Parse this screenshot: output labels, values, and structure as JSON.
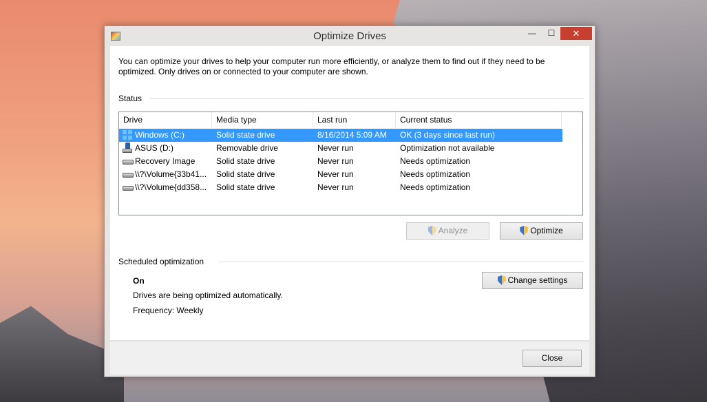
{
  "window": {
    "title": "Optimize Drives",
    "minimize_glyph": "—",
    "maximize_glyph": "☐",
    "close_glyph": "✕"
  },
  "description": "You can optimize your drives to help your computer run more efficiently, or analyze them to find out if they need to be optimized. Only drives on or connected to your computer are shown.",
  "status": {
    "section_label": "Status",
    "columns": [
      "Drive",
      "Media type",
      "Last run",
      "Current status"
    ],
    "drives": [
      {
        "icon": "windows-drive-icon",
        "drive": "Windows (C:)",
        "media_type": "Solid state drive",
        "last_run": "8/16/2014 5:09 AM",
        "current_status": "OK (3 days since last run)",
        "selected": true
      },
      {
        "icon": "usb-drive-icon",
        "drive": "ASUS (D:)",
        "media_type": "Removable drive",
        "last_run": "Never run",
        "current_status": "Optimization not available",
        "selected": false
      },
      {
        "icon": "disk-drive-icon",
        "drive": "Recovery Image",
        "media_type": "Solid state drive",
        "last_run": "Never run",
        "current_status": "Needs optimization",
        "selected": false
      },
      {
        "icon": "disk-drive-icon",
        "drive": "\\\\?\\Volume{33b41...",
        "media_type": "Solid state drive",
        "last_run": "Never run",
        "current_status": "Needs optimization",
        "selected": false
      },
      {
        "icon": "disk-drive-icon",
        "drive": "\\\\?\\Volume{dd358...",
        "media_type": "Solid state drive",
        "last_run": "Never run",
        "current_status": "Needs optimization",
        "selected": false
      }
    ]
  },
  "actions": {
    "analyze_label": "Analyze",
    "optimize_label": "Optimize"
  },
  "scheduled": {
    "section_label": "Scheduled optimization",
    "state": "On",
    "message": "Drives are being optimized automatically.",
    "frequency": "Frequency: Weekly",
    "change_settings_label": "Change settings"
  },
  "footer": {
    "close_label": "Close"
  },
  "colors": {
    "selection": "#3399ff",
    "close_button": "#c7402f"
  }
}
